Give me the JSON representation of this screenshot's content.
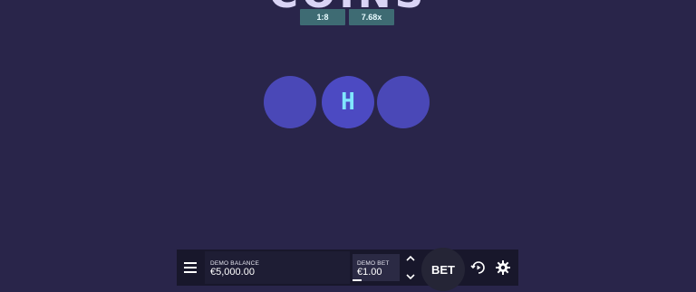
{
  "game": {
    "title": "COINS"
  },
  "odds": {
    "ratio": "1:8",
    "multiplier": "7.68x"
  },
  "coins": [
    {
      "face": ""
    },
    {
      "face": "H"
    },
    {
      "face": ""
    }
  ],
  "controls": {
    "balance_label": "DEMO BALANCE",
    "balance_value": "€5,000.00",
    "bet_label": "DEMO BET",
    "bet_value": "€1.00",
    "bet_button": "BET"
  },
  "icons": {
    "menu": "menu-icon",
    "increase": "chevron-up-icon",
    "decrease": "chevron-down-icon",
    "autoplay": "autoplay-icon",
    "settings": "gear-icon"
  },
  "colors": {
    "background": "#29254a",
    "coin": "#4a48b7",
    "coin_face": "#80e6ff",
    "odds_badge": "#3e6b73",
    "control_bar": "#18172b"
  }
}
